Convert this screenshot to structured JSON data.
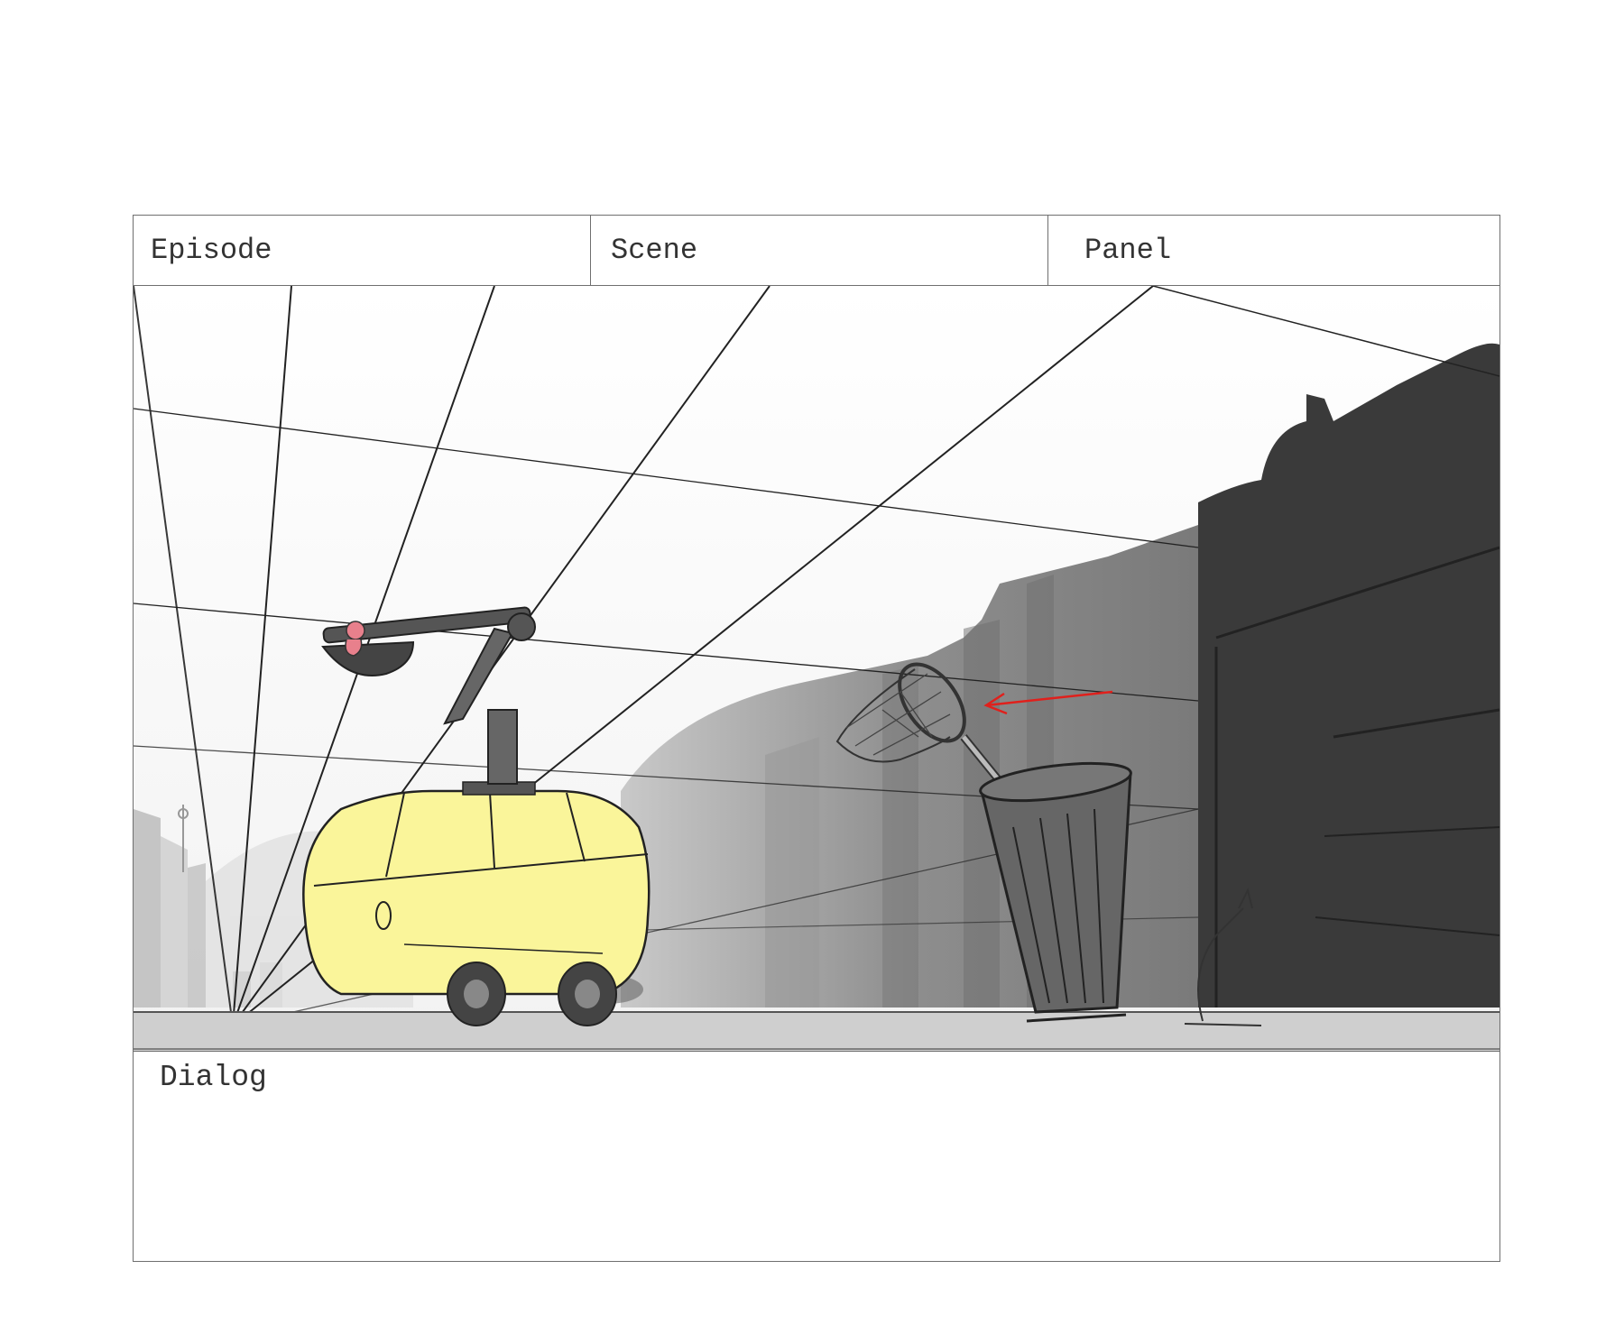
{
  "header": {
    "episode_label": "Episode",
    "scene_label": "Scene",
    "panel_label": "Panel"
  },
  "dialog": {
    "label": "Dialog"
  },
  "colors": {
    "frame_border": "#6f6f6f",
    "van_fill": "#faf59a",
    "motion_arrow": "#e0201c",
    "building_dark": "#3a3a3a",
    "building_mid": "#8c8c8c",
    "character_pink": "#e8808c"
  }
}
